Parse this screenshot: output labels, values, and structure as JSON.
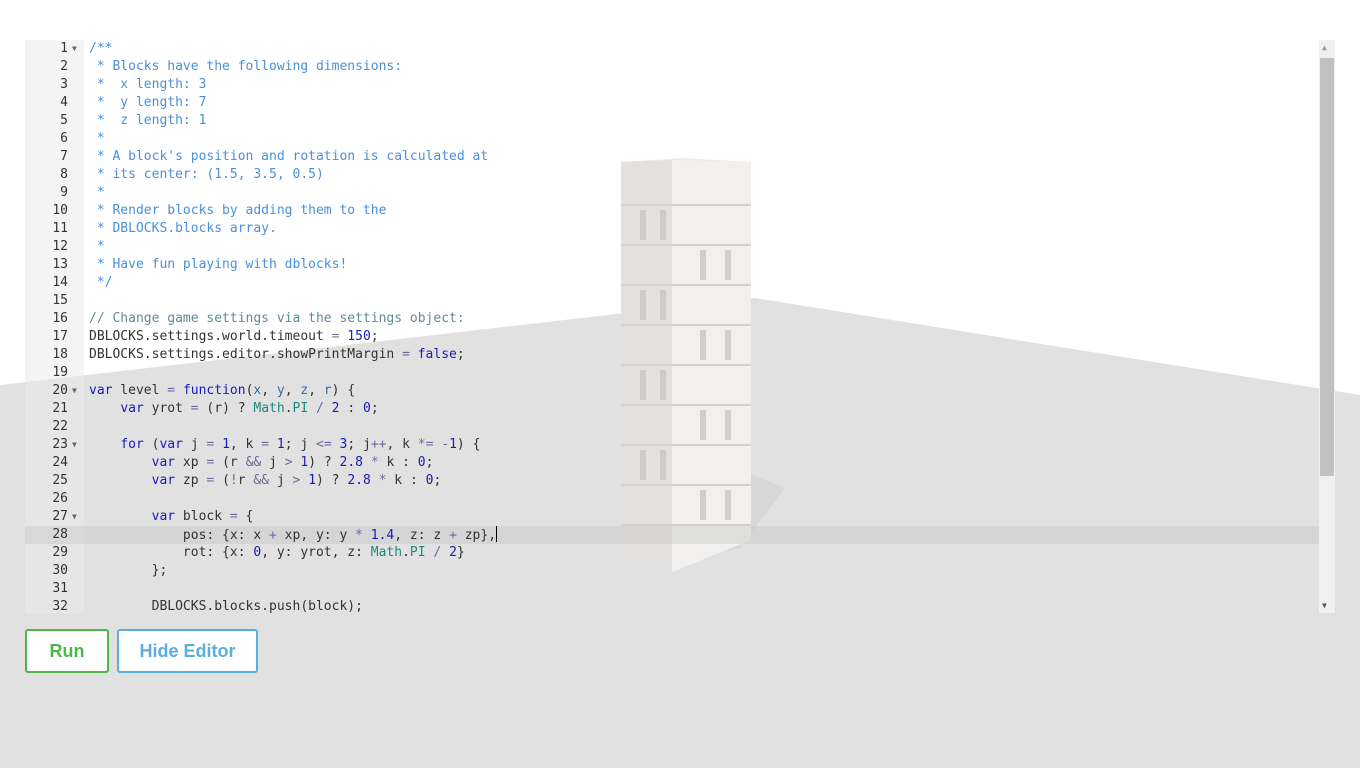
{
  "editor": {
    "lines": [
      {
        "n": "1",
        "fold": true,
        "tokens": [
          [
            "c",
            "/**"
          ]
        ]
      },
      {
        "n": "2",
        "tokens": [
          [
            "c",
            " * Blocks have the following dimensions:"
          ]
        ]
      },
      {
        "n": "3",
        "tokens": [
          [
            "c",
            " *  x length: 3"
          ]
        ]
      },
      {
        "n": "4",
        "tokens": [
          [
            "c",
            " *  y length: 7"
          ]
        ]
      },
      {
        "n": "5",
        "tokens": [
          [
            "c",
            " *  z length: 1"
          ]
        ]
      },
      {
        "n": "6",
        "tokens": [
          [
            "c",
            " *"
          ]
        ]
      },
      {
        "n": "7",
        "tokens": [
          [
            "c",
            " * A block's position and rotation is calculated at"
          ]
        ]
      },
      {
        "n": "8",
        "tokens": [
          [
            "c",
            " * its center: (1.5, 3.5, 0.5)"
          ]
        ]
      },
      {
        "n": "9",
        "tokens": [
          [
            "c",
            " *"
          ]
        ]
      },
      {
        "n": "10",
        "tokens": [
          [
            "c",
            " * Render blocks by adding them to the"
          ]
        ]
      },
      {
        "n": "11",
        "tokens": [
          [
            "c",
            " * DBLOCKS.blocks array."
          ]
        ]
      },
      {
        "n": "12",
        "tokens": [
          [
            "c",
            " *"
          ]
        ]
      },
      {
        "n": "13",
        "tokens": [
          [
            "c",
            " * Have fun playing with dblocks!"
          ]
        ]
      },
      {
        "n": "14",
        "tokens": [
          [
            "c",
            " */"
          ]
        ]
      },
      {
        "n": "15",
        "tokens": []
      },
      {
        "n": "16",
        "tokens": [
          [
            "c2",
            "// Change game settings via the settings object:"
          ]
        ]
      },
      {
        "n": "17",
        "tokens": [
          [
            "p",
            "DBLOCKS.settings.world.timeout "
          ],
          [
            "o",
            "="
          ],
          [
            "p",
            " "
          ],
          [
            "n",
            "150"
          ],
          [
            "p",
            ";"
          ]
        ]
      },
      {
        "n": "18",
        "tokens": [
          [
            "p",
            "DBLOCKS.settings.editor.showPrintMargin "
          ],
          [
            "o",
            "="
          ],
          [
            "p",
            " "
          ],
          [
            "k",
            "false"
          ],
          [
            "p",
            ";"
          ]
        ]
      },
      {
        "n": "19",
        "tokens": []
      },
      {
        "n": "20",
        "fold": true,
        "tokens": [
          [
            "k",
            "var"
          ],
          [
            "p",
            " level "
          ],
          [
            "o",
            "="
          ],
          [
            "p",
            " "
          ],
          [
            "k",
            "function"
          ],
          [
            "p",
            "("
          ],
          [
            "a",
            "x"
          ],
          [
            "p",
            ", "
          ],
          [
            "a",
            "y"
          ],
          [
            "p",
            ", "
          ],
          [
            "a",
            "z"
          ],
          [
            "p",
            ", "
          ],
          [
            "a",
            "r"
          ],
          [
            "p",
            ") {"
          ]
        ]
      },
      {
        "n": "21",
        "tokens": [
          [
            "p",
            "    "
          ],
          [
            "k",
            "var"
          ],
          [
            "p",
            " yrot "
          ],
          [
            "o",
            "="
          ],
          [
            "p",
            " (r) ? "
          ],
          [
            "t",
            "Math"
          ],
          [
            "p",
            "."
          ],
          [
            "t",
            "PI"
          ],
          [
            "p",
            " "
          ],
          [
            "o",
            "/"
          ],
          [
            "p",
            " "
          ],
          [
            "n",
            "2"
          ],
          [
            "p",
            " : "
          ],
          [
            "n",
            "0"
          ],
          [
            "p",
            ";"
          ]
        ]
      },
      {
        "n": "22",
        "tokens": []
      },
      {
        "n": "23",
        "fold": true,
        "tokens": [
          [
            "p",
            "    "
          ],
          [
            "k",
            "for"
          ],
          [
            "p",
            " ("
          ],
          [
            "k",
            "var"
          ],
          [
            "p",
            " j "
          ],
          [
            "o",
            "="
          ],
          [
            "p",
            " "
          ],
          [
            "n",
            "1"
          ],
          [
            "p",
            ", k "
          ],
          [
            "o",
            "="
          ],
          [
            "p",
            " "
          ],
          [
            "n",
            "1"
          ],
          [
            "p",
            "; j "
          ],
          [
            "o",
            "<="
          ],
          [
            "p",
            " "
          ],
          [
            "n",
            "3"
          ],
          [
            "p",
            "; j"
          ],
          [
            "o",
            "++"
          ],
          [
            "p",
            ", k "
          ],
          [
            "o",
            "*="
          ],
          [
            "p",
            " "
          ],
          [
            "o",
            "-"
          ],
          [
            "n",
            "1"
          ],
          [
            "p",
            ") {"
          ]
        ]
      },
      {
        "n": "24",
        "tokens": [
          [
            "p",
            "        "
          ],
          [
            "k",
            "var"
          ],
          [
            "p",
            " xp "
          ],
          [
            "o",
            "="
          ],
          [
            "p",
            " (r "
          ],
          [
            "o",
            "&&"
          ],
          [
            "p",
            " j "
          ],
          [
            "o",
            ">"
          ],
          [
            "p",
            " "
          ],
          [
            "n",
            "1"
          ],
          [
            "p",
            ") ? "
          ],
          [
            "n",
            "2.8"
          ],
          [
            "p",
            " "
          ],
          [
            "o",
            "*"
          ],
          [
            "p",
            " k : "
          ],
          [
            "n",
            "0"
          ],
          [
            "p",
            ";"
          ]
        ]
      },
      {
        "n": "25",
        "tokens": [
          [
            "p",
            "        "
          ],
          [
            "k",
            "var"
          ],
          [
            "p",
            " zp "
          ],
          [
            "o",
            "="
          ],
          [
            "p",
            " ("
          ],
          [
            "o",
            "!"
          ],
          [
            "p",
            "r "
          ],
          [
            "o",
            "&&"
          ],
          [
            "p",
            " j "
          ],
          [
            "o",
            ">"
          ],
          [
            "p",
            " "
          ],
          [
            "n",
            "1"
          ],
          [
            "p",
            ") ? "
          ],
          [
            "n",
            "2.8"
          ],
          [
            "p",
            " "
          ],
          [
            "o",
            "*"
          ],
          [
            "p",
            " k : "
          ],
          [
            "n",
            "0"
          ],
          [
            "p",
            ";"
          ]
        ]
      },
      {
        "n": "26",
        "tokens": []
      },
      {
        "n": "27",
        "fold": true,
        "tokens": [
          [
            "p",
            "        "
          ],
          [
            "k",
            "var"
          ],
          [
            "p",
            " block "
          ],
          [
            "o",
            "="
          ],
          [
            "p",
            " {"
          ]
        ]
      },
      {
        "n": "28",
        "active": true,
        "cursor": true,
        "tokens": [
          [
            "p",
            "            pos: {x: x "
          ],
          [
            "o",
            "+"
          ],
          [
            "p",
            " xp, y: y "
          ],
          [
            "o",
            "*"
          ],
          [
            "p",
            " "
          ],
          [
            "n",
            "1.4"
          ],
          [
            "p",
            ", z: z "
          ],
          [
            "o",
            "+"
          ],
          [
            "p",
            " zp},"
          ]
        ]
      },
      {
        "n": "29",
        "tokens": [
          [
            "p",
            "            rot: {x: "
          ],
          [
            "n",
            "0"
          ],
          [
            "p",
            ", y: yrot, z: "
          ],
          [
            "t",
            "Math"
          ],
          [
            "p",
            "."
          ],
          [
            "t",
            "PI"
          ],
          [
            "p",
            " "
          ],
          [
            "o",
            "/"
          ],
          [
            "p",
            " "
          ],
          [
            "n",
            "2"
          ],
          [
            "p",
            "}"
          ]
        ]
      },
      {
        "n": "30",
        "tokens": [
          [
            "p",
            "        };"
          ]
        ]
      },
      {
        "n": "31",
        "tokens": []
      },
      {
        "n": "32",
        "tokens": [
          [
            "p",
            "        DBLOCKS.blocks.push(block);"
          ]
        ]
      }
    ]
  },
  "buttons": {
    "run_label": "Run",
    "hide_editor_label": "Hide Editor"
  },
  "colors": {
    "run": "#4cb84c",
    "hide_editor": "#5aaee0"
  }
}
